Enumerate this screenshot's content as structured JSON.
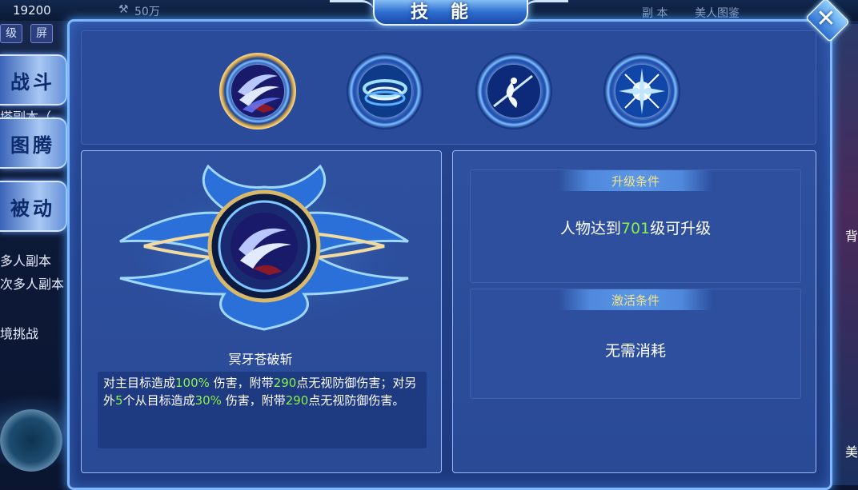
{
  "hud": {
    "power_value": "19200",
    "currency_value": "50万",
    "tab_level": "级",
    "tab_screen": "屏",
    "top_right_1": "副 本",
    "top_right_2": "美人图鉴"
  },
  "sidebar": {
    "buttons": [
      {
        "label": "战斗"
      },
      {
        "label": "图腾"
      },
      {
        "label": "被动"
      }
    ],
    "texts": [
      "塔副本（-",
      "多人副本",
      "次多人副本",
      "境挑战"
    ]
  },
  "right_edge": {
    "char_1": "背",
    "char_2": "美"
  },
  "dialog": {
    "title": "技能",
    "close_label": "✕"
  },
  "skills": [
    {
      "icon": "dark-fang-slash-icon",
      "selected": true
    },
    {
      "icon": "whirlwind-icon",
      "selected": false
    },
    {
      "icon": "sword-dancer-icon",
      "selected": false
    },
    {
      "icon": "lightning-burst-icon",
      "selected": false
    }
  ],
  "selected_skill": {
    "name": "冥牙苍破斩",
    "desc_parts": {
      "p1": "对主目标造成",
      "v1": "100%",
      "p2": " 伤害，附带",
      "v2": "290",
      "p3": "点无视防御伤害；对另外",
      "v3": "5",
      "p4": "个从目标造成",
      "v4": "30%",
      "p5": " 伤害，附带",
      "v5": "290",
      "p6": "点无视防御伤害。"
    }
  },
  "upgrade": {
    "header": "升级条件",
    "text_before": "人物达到",
    "level": "701",
    "text_after": "级可升级"
  },
  "activate": {
    "header": "激活条件",
    "text": "无需消耗"
  },
  "colors": {
    "highlight": "#8af04a",
    "header_gold": "#f4e48a",
    "panel_blue": "#21408a"
  }
}
